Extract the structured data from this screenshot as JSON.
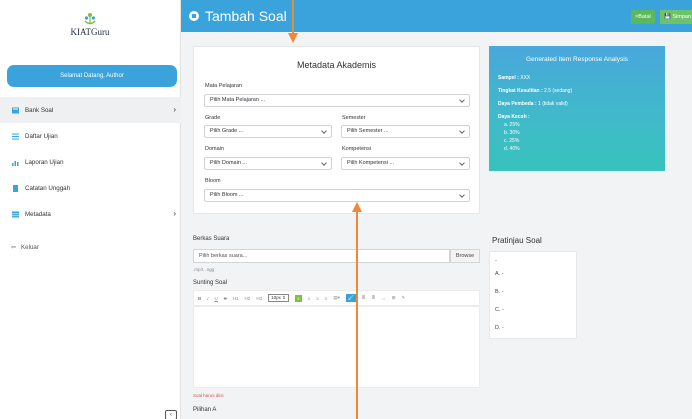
{
  "app": {
    "logo_text": "KIATGuru",
    "welcome": "Selamat Datang, Author"
  },
  "header": {
    "title": "Tambah Soal",
    "batal_label": "×Batal",
    "simpan_label": "💾 Simpan"
  },
  "sidebar": {
    "items": [
      {
        "label": "Bank Soal",
        "icon": "book-icon",
        "active": true,
        "has_chevron": true
      },
      {
        "label": "Daftar Ujian",
        "icon": "list-icon",
        "active": false,
        "has_chevron": false
      },
      {
        "label": "Laporan Ujian",
        "icon": "chart-icon",
        "active": false,
        "has_chevron": false
      },
      {
        "label": "Catatan Unggah",
        "icon": "file-icon",
        "active": false,
        "has_chevron": false
      },
      {
        "label": "Metadata",
        "icon": "table-icon",
        "active": false,
        "has_chevron": true
      }
    ],
    "logout_label": "Keluar"
  },
  "metadata": {
    "title": "Metadata Akademis",
    "mata_pelajaran": {
      "label": "Mata Pelajaran",
      "value": "Pilih Mata Pelajaran ..."
    },
    "grade": {
      "label": "Grade",
      "value": "Pilih Grade ..."
    },
    "semester": {
      "label": "Semester",
      "value": "Pilih Semester ..."
    },
    "domain": {
      "label": "Domain",
      "value": "Pilih Domain ..."
    },
    "kompetensi": {
      "label": "Kompetensi",
      "value": "Pilih Kompetensi ..."
    },
    "bloom": {
      "label": "Bloom",
      "value": "Pilih Bloom ..."
    }
  },
  "analysis": {
    "title": "Generated Item Response Analysis",
    "sampel_label": "Sampel :",
    "sampel_value": "XXX",
    "kesulitan_label": "Tingkat Kesulitan :",
    "kesulitan_value": "2.5 (sedang)",
    "pembeda_label": "Daya Pembeda :",
    "pembeda_value": "1 (tidak valid)",
    "kecoh_label": "Daya Kecoh :",
    "kecoh_options": [
      "a. 25%",
      "b. 30%",
      "c. 25%",
      "d. 40%"
    ]
  },
  "audio": {
    "label": "Berkas Suara",
    "placeholder": "Pilih berkas suara...",
    "browse": "Browse",
    "hint": ".mp3, .ogg"
  },
  "editor": {
    "label": "Sunting Soal",
    "toolbar": [
      "B",
      "I",
      "U",
      "S",
      "H1",
      "H2",
      "H3",
      "10px ⇕",
      "≡",
      "≡",
      "≡",
      "≡",
      "▤▾",
      "🖌",
      "≣",
      "≣",
      "⇔",
      "⊞",
      "✎"
    ],
    "error": "Soal harus diisi",
    "pilihan_label": "Pilihan A"
  },
  "preview": {
    "title": "Pratinjau Soal",
    "lines": [
      "-",
      "A. -",
      "B. -",
      "C. -",
      "D. -"
    ]
  },
  "colors": {
    "primary": "#3aa3dc",
    "success": "#5cb85c",
    "arrow": "#f0883a"
  }
}
